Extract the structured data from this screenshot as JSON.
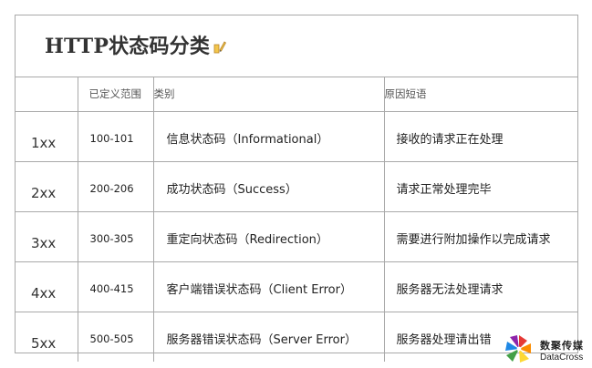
{
  "title": "HTTP状态码分类",
  "table": {
    "headers": {
      "code": "",
      "range": "已定义范围",
      "type": "类别",
      "reason": "原因短语"
    },
    "rows": [
      {
        "code": "1xx",
        "range": "100-101",
        "type": "信息状态码（Informational）",
        "reason": "接收的请求正在处理"
      },
      {
        "code": "2xx",
        "range": "200-206",
        "type": "成功状态码（Success）",
        "reason": "请求正常处理完毕"
      },
      {
        "code": "3xx",
        "range": "300-305",
        "type": "重定向状态码（Redirection）",
        "reason": "需要进行附加操作以完成请求"
      },
      {
        "code": "4xx",
        "range": "400-415",
        "type": "客户端错误状态码（Client Error）",
        "reason": "服务器无法处理请求"
      },
      {
        "code": "5xx",
        "range": "500-505",
        "type": "服务器错误状态码（Server Error）",
        "reason": "服务器处理请出错"
      }
    ]
  },
  "watermark": {
    "cn": "数聚传媒",
    "en": "DataCross"
  },
  "icons": {
    "title_icon": "pencil-icon",
    "logo_icon": "pinwheel-logo-icon"
  },
  "colors": {
    "border": "#a9a9a9",
    "text": "#222222"
  }
}
